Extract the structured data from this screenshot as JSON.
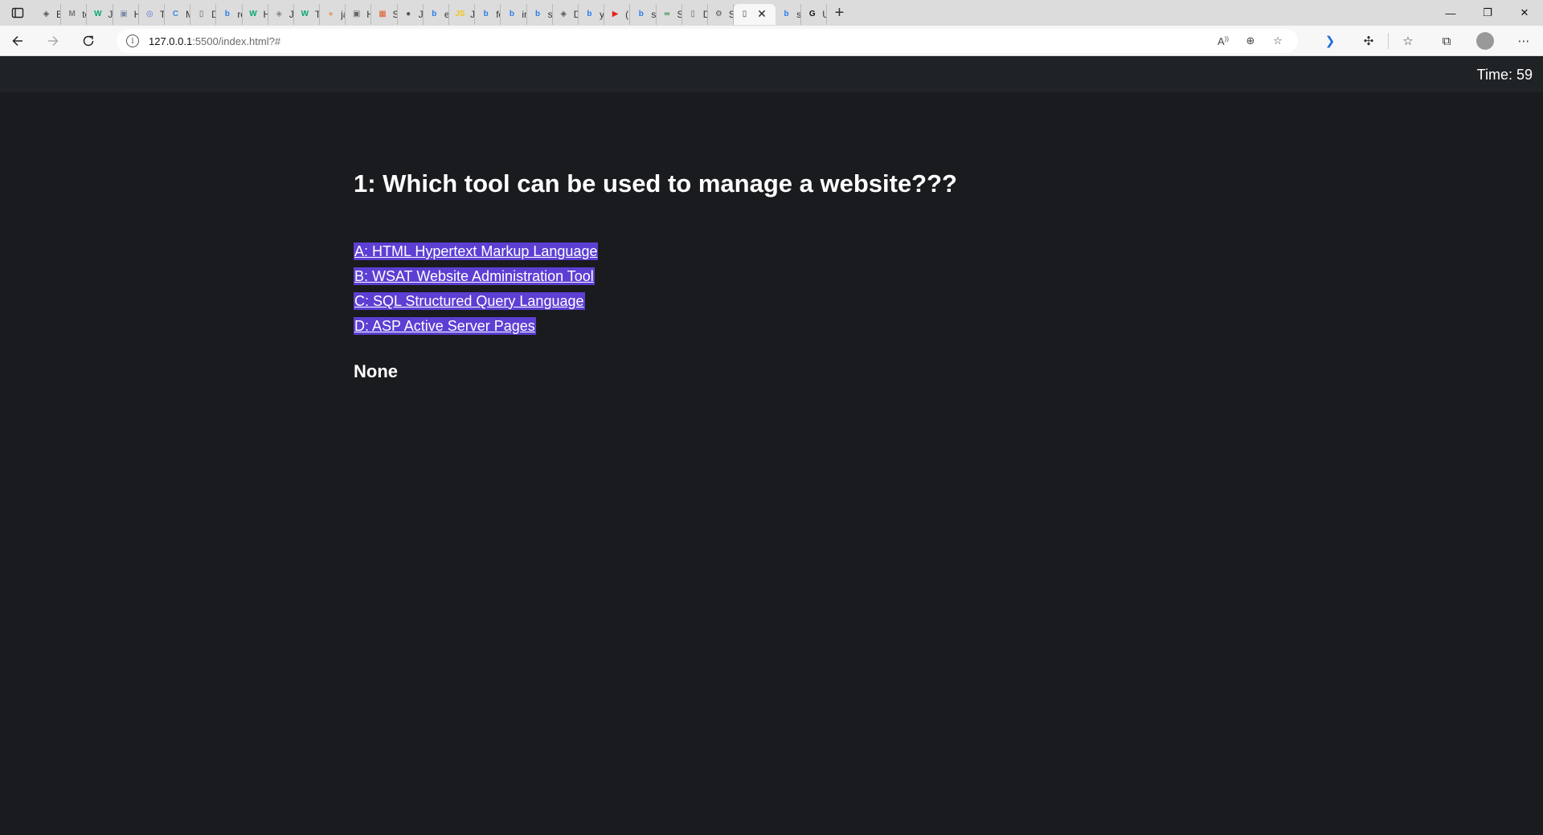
{
  "browser": {
    "tabs": [
      {
        "label": "Boc",
        "icon": "globe-icon",
        "color": "#555555"
      },
      {
        "label": "text",
        "icon": "m-icon",
        "color": "#777777"
      },
      {
        "label": "Java",
        "icon": "w3-icon",
        "color": "#04aa6d"
      },
      {
        "label": "Hov",
        "icon": "image-icon",
        "color": "#7a8aa8"
      },
      {
        "label": "Tick",
        "icon": "shield-icon",
        "color": "#5b6fd6"
      },
      {
        "label": "Mic",
        "icon": "c-icon",
        "color": "#3b8ad9"
      },
      {
        "label": "Doc",
        "icon": "page-icon",
        "color": "#666666"
      },
      {
        "label": "rem",
        "icon": "bing-icon",
        "color": "#2b7de9"
      },
      {
        "label": "HTI",
        "icon": "w3-icon",
        "color": "#04aa6d"
      },
      {
        "label": "Java",
        "icon": "globe-icon",
        "color": "#888888"
      },
      {
        "label": "Try",
        "icon": "w3-icon",
        "color": "#04aa6d"
      },
      {
        "label": "java",
        "icon": "user-icon",
        "color": "#e0a070"
      },
      {
        "label": "HTI",
        "icon": "image-icon",
        "color": "#666666"
      },
      {
        "label": "Sig",
        "icon": "grid-icon",
        "color": "#e05a2b"
      },
      {
        "label": "Java",
        "icon": "gh-icon",
        "color": "#555555"
      },
      {
        "label": "eve",
        "icon": "bing-icon",
        "color": "#2b7de9"
      },
      {
        "label": "Java",
        "icon": "js-icon",
        "color": "#f0c419"
      },
      {
        "label": "forr",
        "icon": "bing-icon",
        "color": "#2b7de9"
      },
      {
        "label": "inse",
        "icon": "bing-icon",
        "color": "#2b7de9"
      },
      {
        "label": "sele",
        "icon": "bing-icon",
        "color": "#2b7de9"
      },
      {
        "label": "Dat",
        "icon": "globe-icon",
        "color": "#555555"
      },
      {
        "label": "yot",
        "icon": "bing-icon",
        "color": "#2b7de9"
      },
      {
        "label": "(10",
        "icon": "youtube-icon",
        "color": "#e62117"
      },
      {
        "label": "sele",
        "icon": "bing-icon",
        "color": "#2b7de9"
      },
      {
        "label": "Sele",
        "icon": "gfg-icon",
        "color": "#2f8d46"
      },
      {
        "label": "Doc",
        "icon": "page-icon",
        "color": "#666666"
      },
      {
        "label": "Set",
        "icon": "gear-icon",
        "color": "#555555"
      }
    ],
    "active_tab": {
      "icon": "page-icon",
      "close": "✕"
    },
    "tabs_after": [
      {
        "label": "scri",
        "icon": "bing-icon",
        "color": "#2b7de9"
      },
      {
        "label": "Unt",
        "icon": "g-icon",
        "color": "#111111"
      }
    ],
    "new_tab": "+",
    "window_controls": {
      "minimize": "—",
      "restore": "❐",
      "close": "✕"
    },
    "url": {
      "host": "127.0.0.1",
      "rest": ":5500/index.html?#"
    },
    "info_glyph": "i"
  },
  "quiz": {
    "timer": "Time: 59",
    "question": "1: Which tool can be used to manage a website???",
    "answers": [
      "A: HTML Hypertext Markup Language",
      "B: WSAT Website Administration Tool",
      "C: SQL Structured Query Language",
      "D: ASP Active Server Pages"
    ],
    "result": "None"
  },
  "colors": {
    "page_bg": "#1a1b1e",
    "topbar_bg": "#202326",
    "answer_bg": "#5d3fd3",
    "text": "#ffffff"
  }
}
